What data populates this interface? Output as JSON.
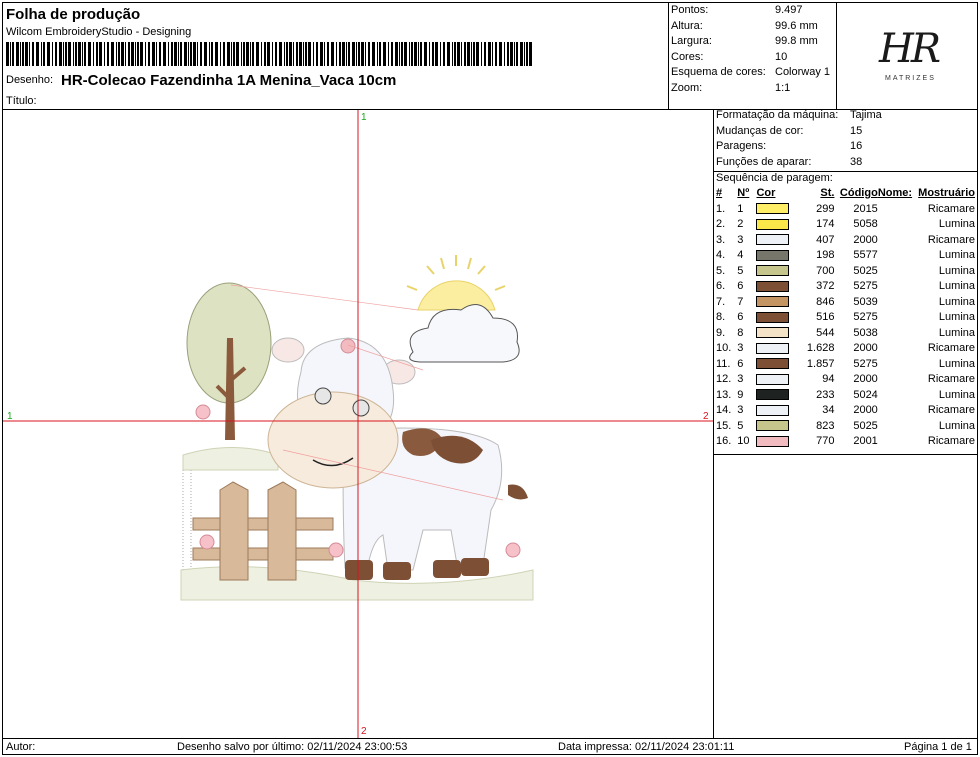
{
  "header": {
    "title": "Folha de produção",
    "software": "Wilcom EmbroideryStudio - Designing",
    "design_label": "Desenho:",
    "design_name": "HR-Colecao Fazendinha 1A Menina_Vaca 10cm",
    "title_label": "Título:"
  },
  "stats": [
    {
      "label": "Pontos:",
      "value": "9.497"
    },
    {
      "label": "Altura:",
      "value": "99.6 mm"
    },
    {
      "label": "Largura:",
      "value": "99.8 mm"
    },
    {
      "label": "Cores:",
      "value": "10"
    },
    {
      "label": "Esquema de cores:",
      "value": "Colorway 1"
    },
    {
      "label": "Zoom:",
      "value": "1:1"
    }
  ],
  "logo": {
    "mark": "HR",
    "subtitle": "MATRIZES"
  },
  "machine": [
    {
      "label": "Formatação da máquina:",
      "value": "Tajima"
    },
    {
      "label": "Mudanças de cor:",
      "value": "15"
    },
    {
      "label": "Paragens:",
      "value": "16"
    },
    {
      "label": "Funções de aparar:",
      "value": "38"
    }
  ],
  "sequence": {
    "title": "Sequência de paragem:",
    "columns": [
      "#",
      "Nº",
      "Cor",
      "St.",
      "Código",
      "Nome:",
      "Mostruário"
    ],
    "rows": [
      {
        "idx": "1.",
        "n": "1",
        "color": "#FFEE66",
        "st": "299",
        "code": "2015",
        "name": "",
        "brand": "Ricamare"
      },
      {
        "idx": "2.",
        "n": "2",
        "color": "#FAE84A",
        "st": "174",
        "code": "5058",
        "name": "",
        "brand": "Lumina"
      },
      {
        "idx": "3.",
        "n": "3",
        "color": "#EEF1F6",
        "st": "407",
        "code": "2000",
        "name": "",
        "brand": "Ricamare"
      },
      {
        "idx": "4.",
        "n": "4",
        "color": "#77766A",
        "st": "198",
        "code": "5577",
        "name": "",
        "brand": "Lumina"
      },
      {
        "idx": "5.",
        "n": "5",
        "color": "#C6C68C",
        "st": "700",
        "code": "5025",
        "name": "",
        "brand": "Lumina"
      },
      {
        "idx": "6.",
        "n": "6",
        "color": "#7D5036",
        "st": "372",
        "code": "5275",
        "name": "",
        "brand": "Lumina"
      },
      {
        "idx": "7.",
        "n": "7",
        "color": "#C49462",
        "st": "846",
        "code": "5039",
        "name": "",
        "brand": "Lumina"
      },
      {
        "idx": "8.",
        "n": "6",
        "color": "#7D5036",
        "st": "516",
        "code": "5275",
        "name": "",
        "brand": "Lumina"
      },
      {
        "idx": "9.",
        "n": "8",
        "color": "#F5E3C8",
        "st": "544",
        "code": "5038",
        "name": "",
        "brand": "Lumina"
      },
      {
        "idx": "10.",
        "n": "3",
        "color": "#EEF1F6",
        "st": "1.628",
        "code": "2000",
        "name": "",
        "brand": "Ricamare"
      },
      {
        "idx": "11.",
        "n": "6",
        "color": "#7D5036",
        "st": "1.857",
        "code": "5275",
        "name": "",
        "brand": "Lumina"
      },
      {
        "idx": "12.",
        "n": "3",
        "color": "#EEF1F6",
        "st": "94",
        "code": "2000",
        "name": "",
        "brand": "Ricamare"
      },
      {
        "idx": "13.",
        "n": "9",
        "color": "#1E2220",
        "st": "233",
        "code": "5024",
        "name": "",
        "brand": "Lumina"
      },
      {
        "idx": "14.",
        "n": "3",
        "color": "#EEF1F6",
        "st": "34",
        "code": "2000",
        "name": "",
        "brand": "Ricamare"
      },
      {
        "idx": "15.",
        "n": "5",
        "color": "#C6C68C",
        "st": "823",
        "code": "5025",
        "name": "",
        "brand": "Lumina"
      },
      {
        "idx": "16.",
        "n": "10",
        "color": "#F2BBC0",
        "st": "770",
        "code": "2001",
        "name": "",
        "brand": "Ricamare"
      }
    ]
  },
  "canvas": {
    "markers": {
      "top": "1",
      "left": "1",
      "right": "2",
      "bottom": "2"
    }
  },
  "footer": {
    "author": "Autor:",
    "saved": "Desenho salvo por último: 02/11/2024 23:00:53",
    "printed": "Data impressa: 02/11/2024 23:01:11",
    "page": "Página 1 de 1"
  }
}
